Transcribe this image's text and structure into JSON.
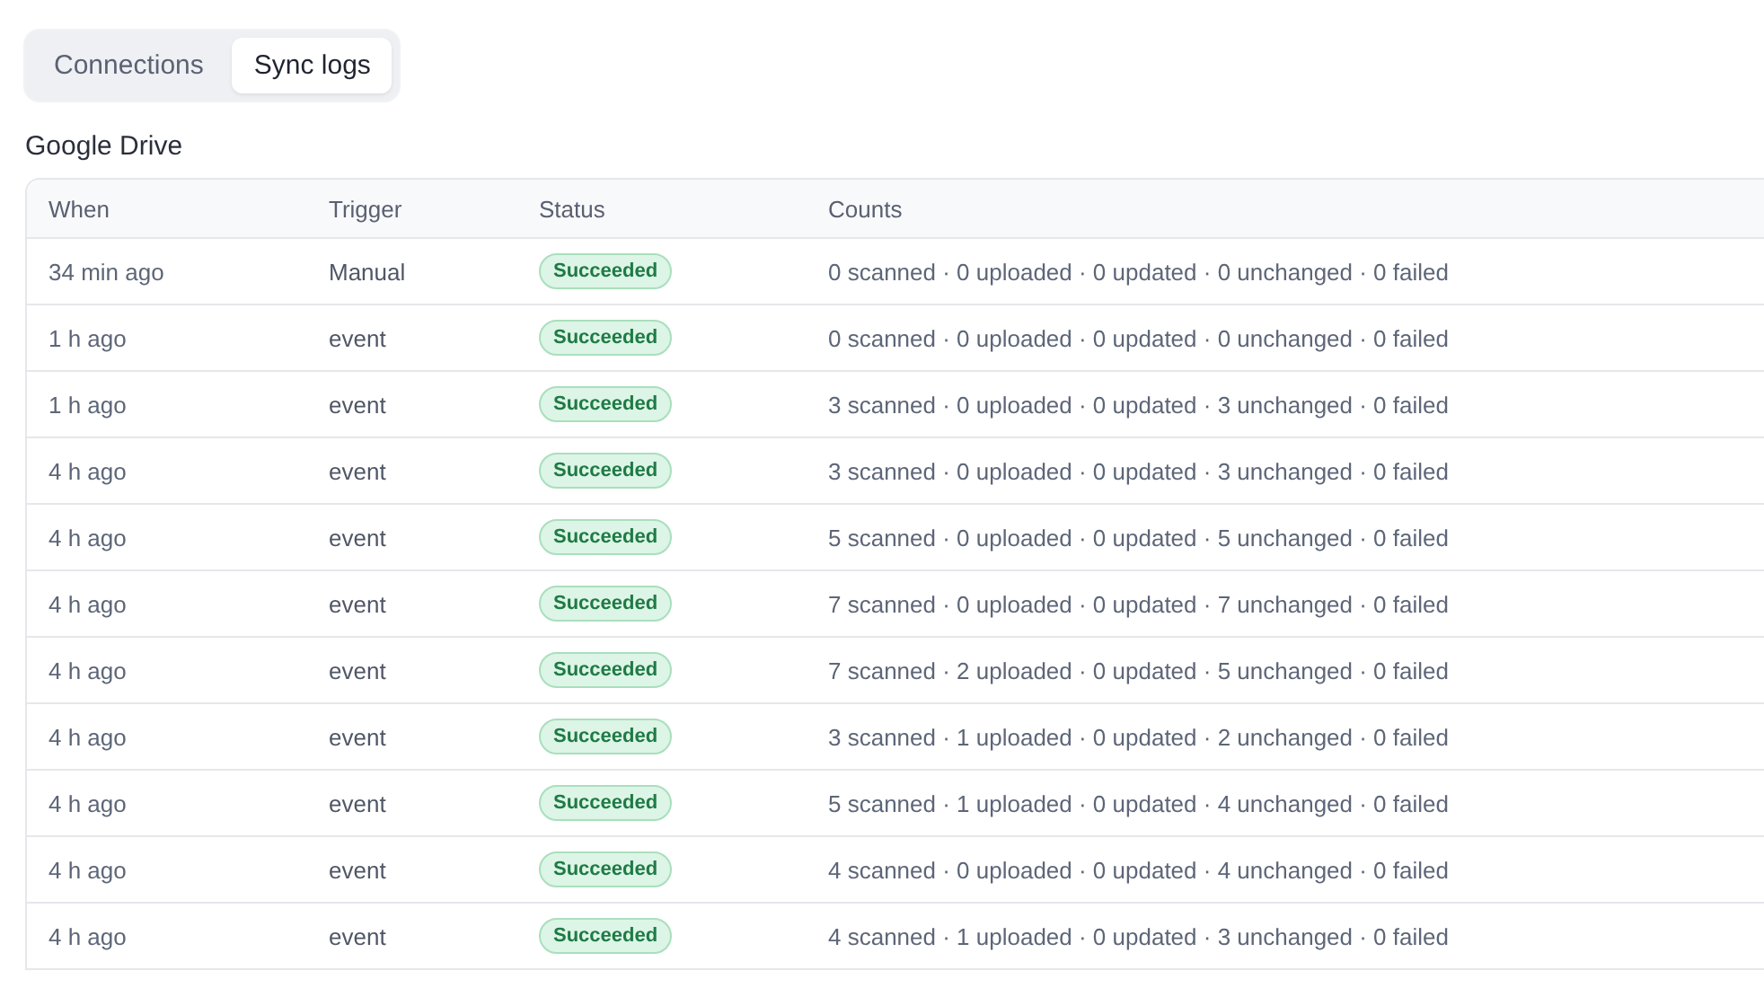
{
  "tabs": [
    {
      "label": "Connections",
      "selected": false
    },
    {
      "label": "Sync logs",
      "selected": true
    }
  ],
  "section_title": "Google Drive",
  "table": {
    "columns": [
      "When",
      "Trigger",
      "Status",
      "Counts"
    ],
    "rows": [
      {
        "when": "34 min ago",
        "trigger": "Manual",
        "status": {
          "label": "Succeeded",
          "kind": "success"
        },
        "counts": "0 scanned · 0 uploaded · 0 updated · 0 unchanged · 0 failed"
      },
      {
        "when": "1 h ago",
        "trigger": "event",
        "status": {
          "label": "Succeeded",
          "kind": "success"
        },
        "counts": "0 scanned · 0 uploaded · 0 updated · 0 unchanged · 0 failed"
      },
      {
        "when": "1 h ago",
        "trigger": "event",
        "status": {
          "label": "Succeeded",
          "kind": "success"
        },
        "counts": "3 scanned · 0 uploaded · 0 updated · 3 unchanged · 0 failed"
      },
      {
        "when": "4 h ago",
        "trigger": "event",
        "status": {
          "label": "Succeeded",
          "kind": "success"
        },
        "counts": "3 scanned · 0 uploaded · 0 updated · 3 unchanged · 0 failed"
      },
      {
        "when": "4 h ago",
        "trigger": "event",
        "status": {
          "label": "Succeeded",
          "kind": "success"
        },
        "counts": "5 scanned · 0 uploaded · 0 updated · 5 unchanged · 0 failed"
      },
      {
        "when": "4 h ago",
        "trigger": "event",
        "status": {
          "label": "Succeeded",
          "kind": "success"
        },
        "counts": "7 scanned · 0 uploaded · 0 updated · 7 unchanged · 0 failed"
      },
      {
        "when": "4 h ago",
        "trigger": "event",
        "status": {
          "label": "Succeeded",
          "kind": "success"
        },
        "counts": "7 scanned · 2 uploaded · 0 updated · 5 unchanged · 0 failed"
      },
      {
        "when": "4 h ago",
        "trigger": "event",
        "status": {
          "label": "Succeeded",
          "kind": "success"
        },
        "counts": "3 scanned · 1 uploaded · 0 updated · 2 unchanged · 0 failed"
      },
      {
        "when": "4 h ago",
        "trigger": "event",
        "status": {
          "label": "Succeeded",
          "kind": "success"
        },
        "counts": "5 scanned · 1 uploaded · 0 updated · 4 unchanged · 0 failed"
      },
      {
        "when": "4 h ago",
        "trigger": "event",
        "status": {
          "label": "Succeeded",
          "kind": "success"
        },
        "counts": "4 scanned · 0 uploaded · 0 updated · 4 unchanged · 0 failed"
      },
      {
        "when": "4 h ago",
        "trigger": "event",
        "status": {
          "label": "Succeeded",
          "kind": "success"
        },
        "counts": "4 scanned · 1 uploaded · 0 updated · 3 unchanged · 0 failed"
      }
    ]
  }
}
